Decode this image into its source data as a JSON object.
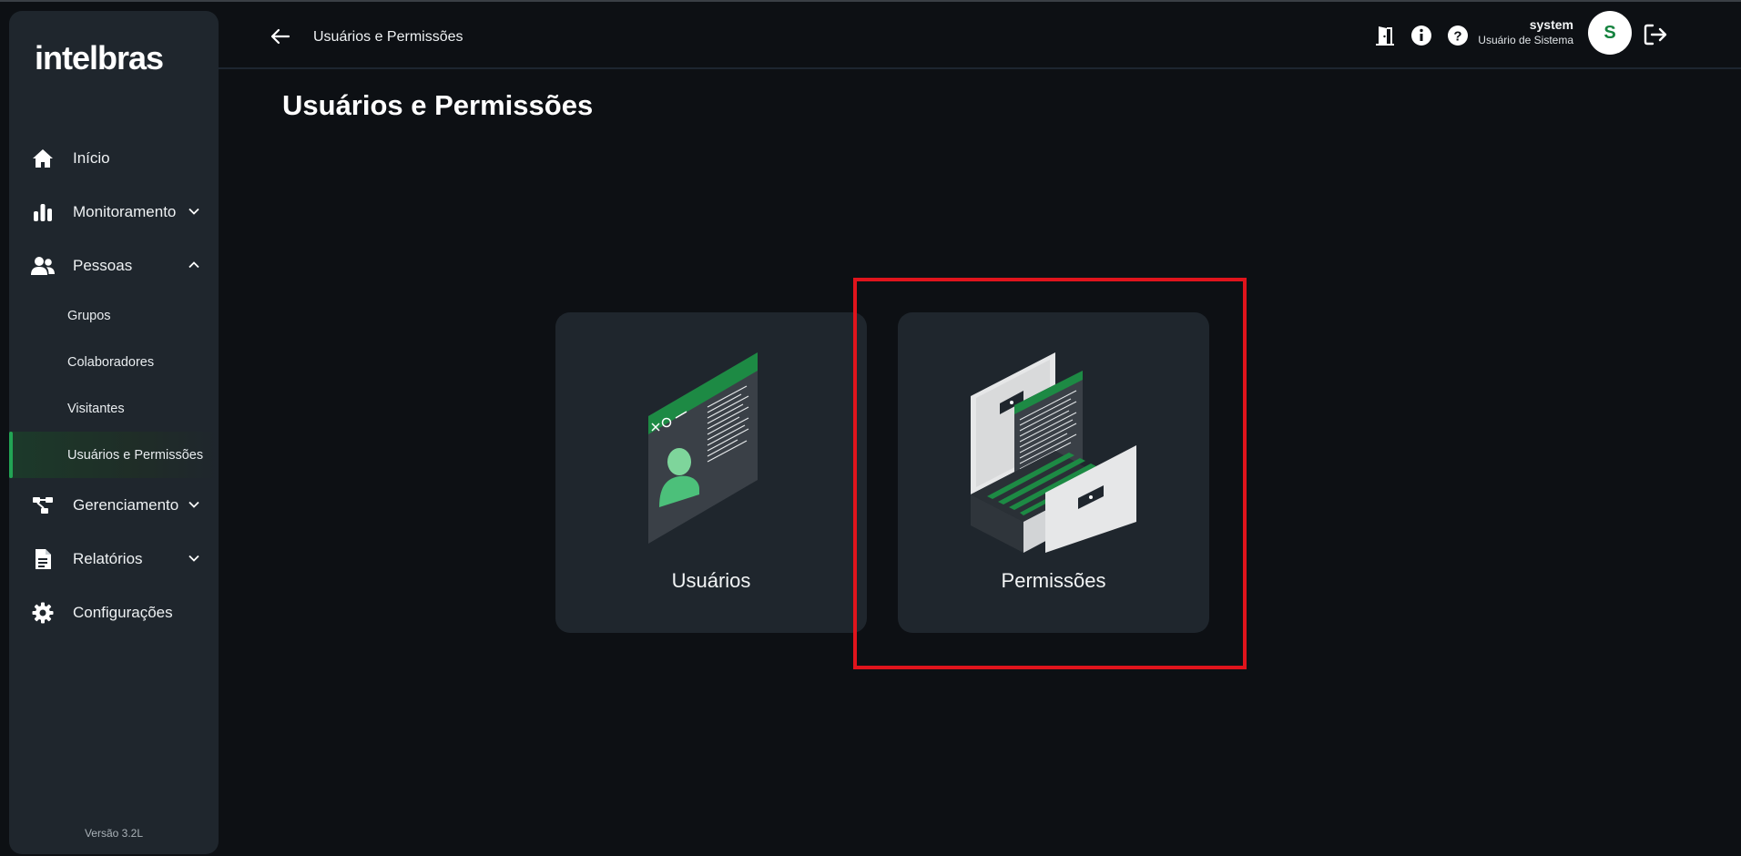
{
  "app": {
    "brand": "intelbras",
    "version_label": "Versão 3.2L"
  },
  "sidebar": {
    "items": [
      {
        "label": "Início",
        "icon": "home-icon"
      },
      {
        "label": "Monitoramento",
        "icon": "bar-chart-icon",
        "chevron": "chevron-down-icon"
      },
      {
        "label": "Pessoas",
        "icon": "people-icon",
        "chevron": "chevron-up-icon"
      },
      {
        "label": "Gerenciamento",
        "icon": "network-icon",
        "chevron": "chevron-down-icon"
      },
      {
        "label": "Relatórios",
        "icon": "document-icon",
        "chevron": "chevron-down-icon"
      },
      {
        "label": "Configurações",
        "icon": "gear-icon"
      }
    ],
    "pessoas_sub": [
      {
        "label": "Grupos"
      },
      {
        "label": "Colaboradores"
      },
      {
        "label": "Visitantes"
      },
      {
        "label": "Usuários e Permissões",
        "active": true
      }
    ]
  },
  "header": {
    "breadcrumb": "Usuários e Permissões",
    "icons": [
      "door-icon",
      "info-icon",
      "help-icon",
      "logout-icon"
    ],
    "user": {
      "name": "system",
      "role": "Usuário de Sistema",
      "initial": "S"
    }
  },
  "main": {
    "title": "Usuários e Permissões",
    "cards": [
      {
        "label": "Usuários",
        "icon": "users-illustration"
      },
      {
        "label": "Permissões",
        "icon": "permissions-illustration"
      }
    ]
  },
  "colors": {
    "accent": "#22a454",
    "highlight": "#e0141c",
    "background": "#0d1014",
    "panel": "#1f262d"
  }
}
